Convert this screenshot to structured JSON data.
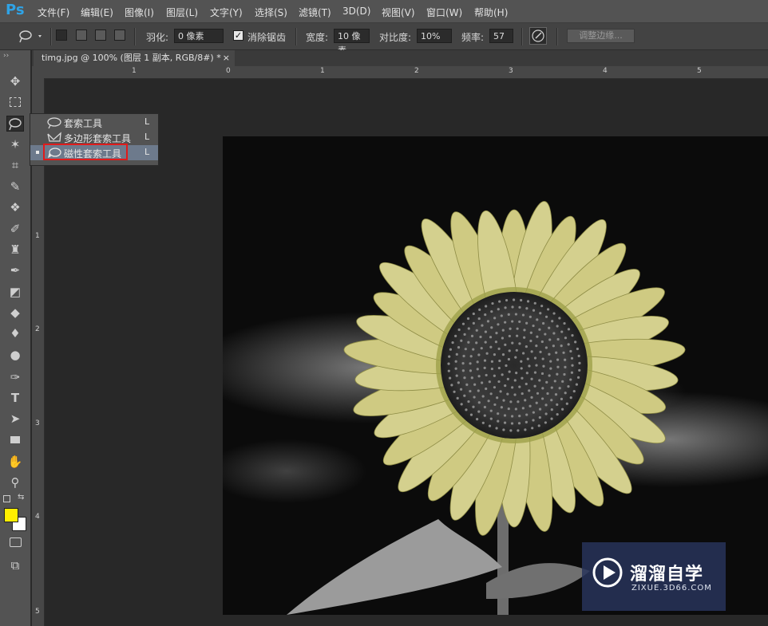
{
  "app": {
    "logo": "Ps"
  },
  "menu": [
    "文件(F)",
    "编辑(E)",
    "图像(I)",
    "图层(L)",
    "文字(Y)",
    "选择(S)",
    "滤镜(T)",
    "3D(D)",
    "视图(V)",
    "窗口(W)",
    "帮助(H)"
  ],
  "options": {
    "feather_label": "羽化:",
    "feather_value": "0 像素",
    "antialias_label": "消除锯齿",
    "width_label": "宽度:",
    "width_value": "10 像素",
    "contrast_label": "对比度:",
    "contrast_value": "10%",
    "frequency_label": "频率:",
    "frequency_value": "57",
    "refine_edge": "调整边缘..."
  },
  "document": {
    "tab_title": "timg.jpg @ 100% (图层 1 副本, RGB/8#) *",
    "close": "×"
  },
  "ruler": {
    "top": [
      "1",
      "0",
      "1",
      "2",
      "3",
      "4",
      "5"
    ],
    "left": [
      "1",
      "2",
      "3",
      "4",
      "5"
    ]
  },
  "flyout": [
    {
      "label": "套索工具",
      "key": "L"
    },
    {
      "label": "多边形套索工具",
      "key": "L"
    },
    {
      "label": "磁性套索工具",
      "key": "L"
    }
  ],
  "colors": {
    "foreground": "#ffee00",
    "background": "#ffffff",
    "highlight_box": "#e01b1b"
  },
  "watermark": {
    "name": "溜溜自学",
    "url": "ZIXUE.3D66.COM"
  }
}
